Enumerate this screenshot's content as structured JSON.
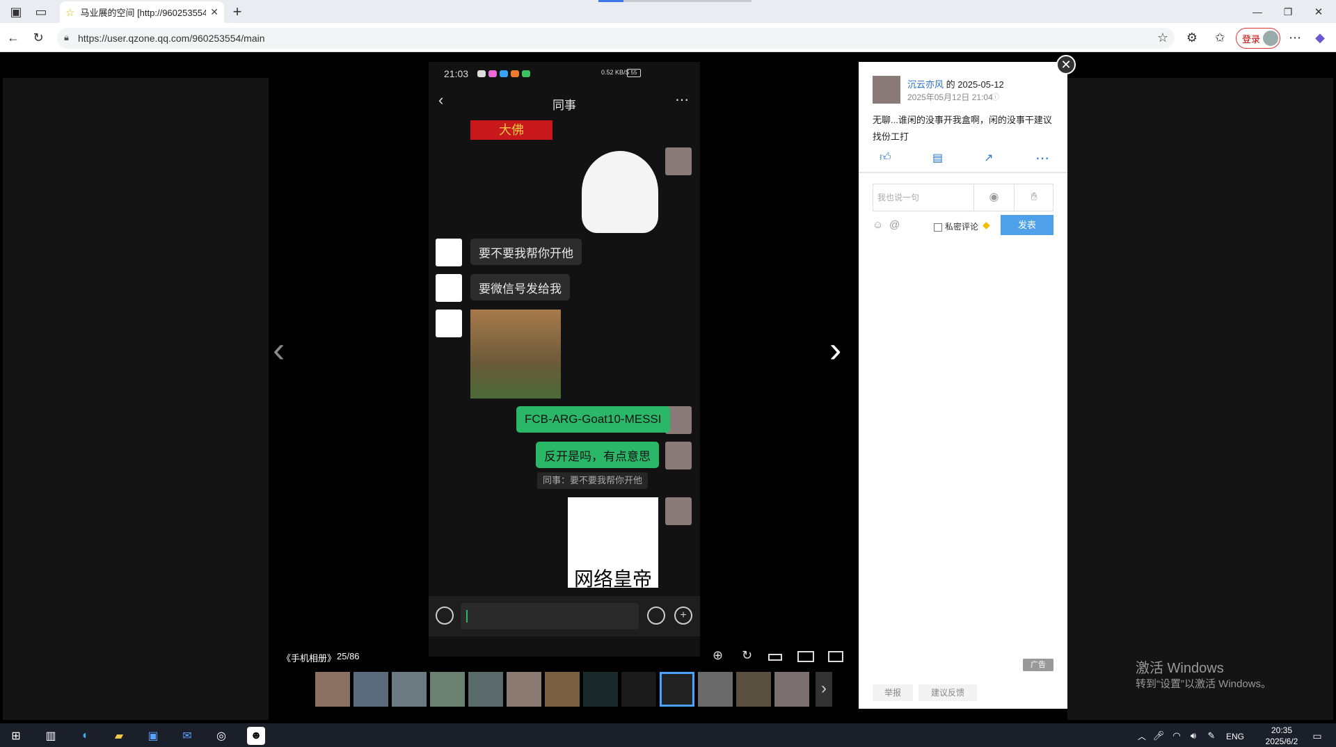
{
  "browser": {
    "tab_title": "马业展的空间 [http://960253554...",
    "url": "https://user.qzone.qq.com/960253554/main",
    "login_label": "登录"
  },
  "phone": {
    "status_time": "21:03",
    "status_speed": "0.52 KB/S",
    "battery": "55",
    "chat_title": "同事",
    "messages": [
      {
        "side": "left",
        "text": "要不要我帮你开他"
      },
      {
        "side": "left",
        "text": "要微信号发给我"
      },
      {
        "side": "right",
        "text": "FCB-ARG-Goat10-MESSI"
      },
      {
        "side": "right",
        "text": "反开是吗，有点意思"
      }
    ],
    "quote": "同事：要不要我帮你开他",
    "meme_caption": "网络皇帝",
    "top_sticker_text": "大佛"
  },
  "album": {
    "name": "《手机相册》",
    "counter": "25/86"
  },
  "post": {
    "author": "沉云亦风",
    "of_label": "的",
    "date": "2025-05-12",
    "datetime": "2025年05月12日 21:04",
    "text": "无聊...谁闲的没事开我盒啊，闲的没事干建议找份工打",
    "comment_placeholder": "我也说一句",
    "private_label": "私密评论",
    "submit_label": "发表",
    "ad_label": "广告",
    "report_label": "举报",
    "feedback_label": "建议反馈"
  },
  "watermark": {
    "title": "激活 Windows",
    "subtitle": "转到“设置”以激活 Windows。"
  },
  "taskbar": {
    "lang": "ENG",
    "time": "20:35",
    "date": "2025/6/2"
  }
}
